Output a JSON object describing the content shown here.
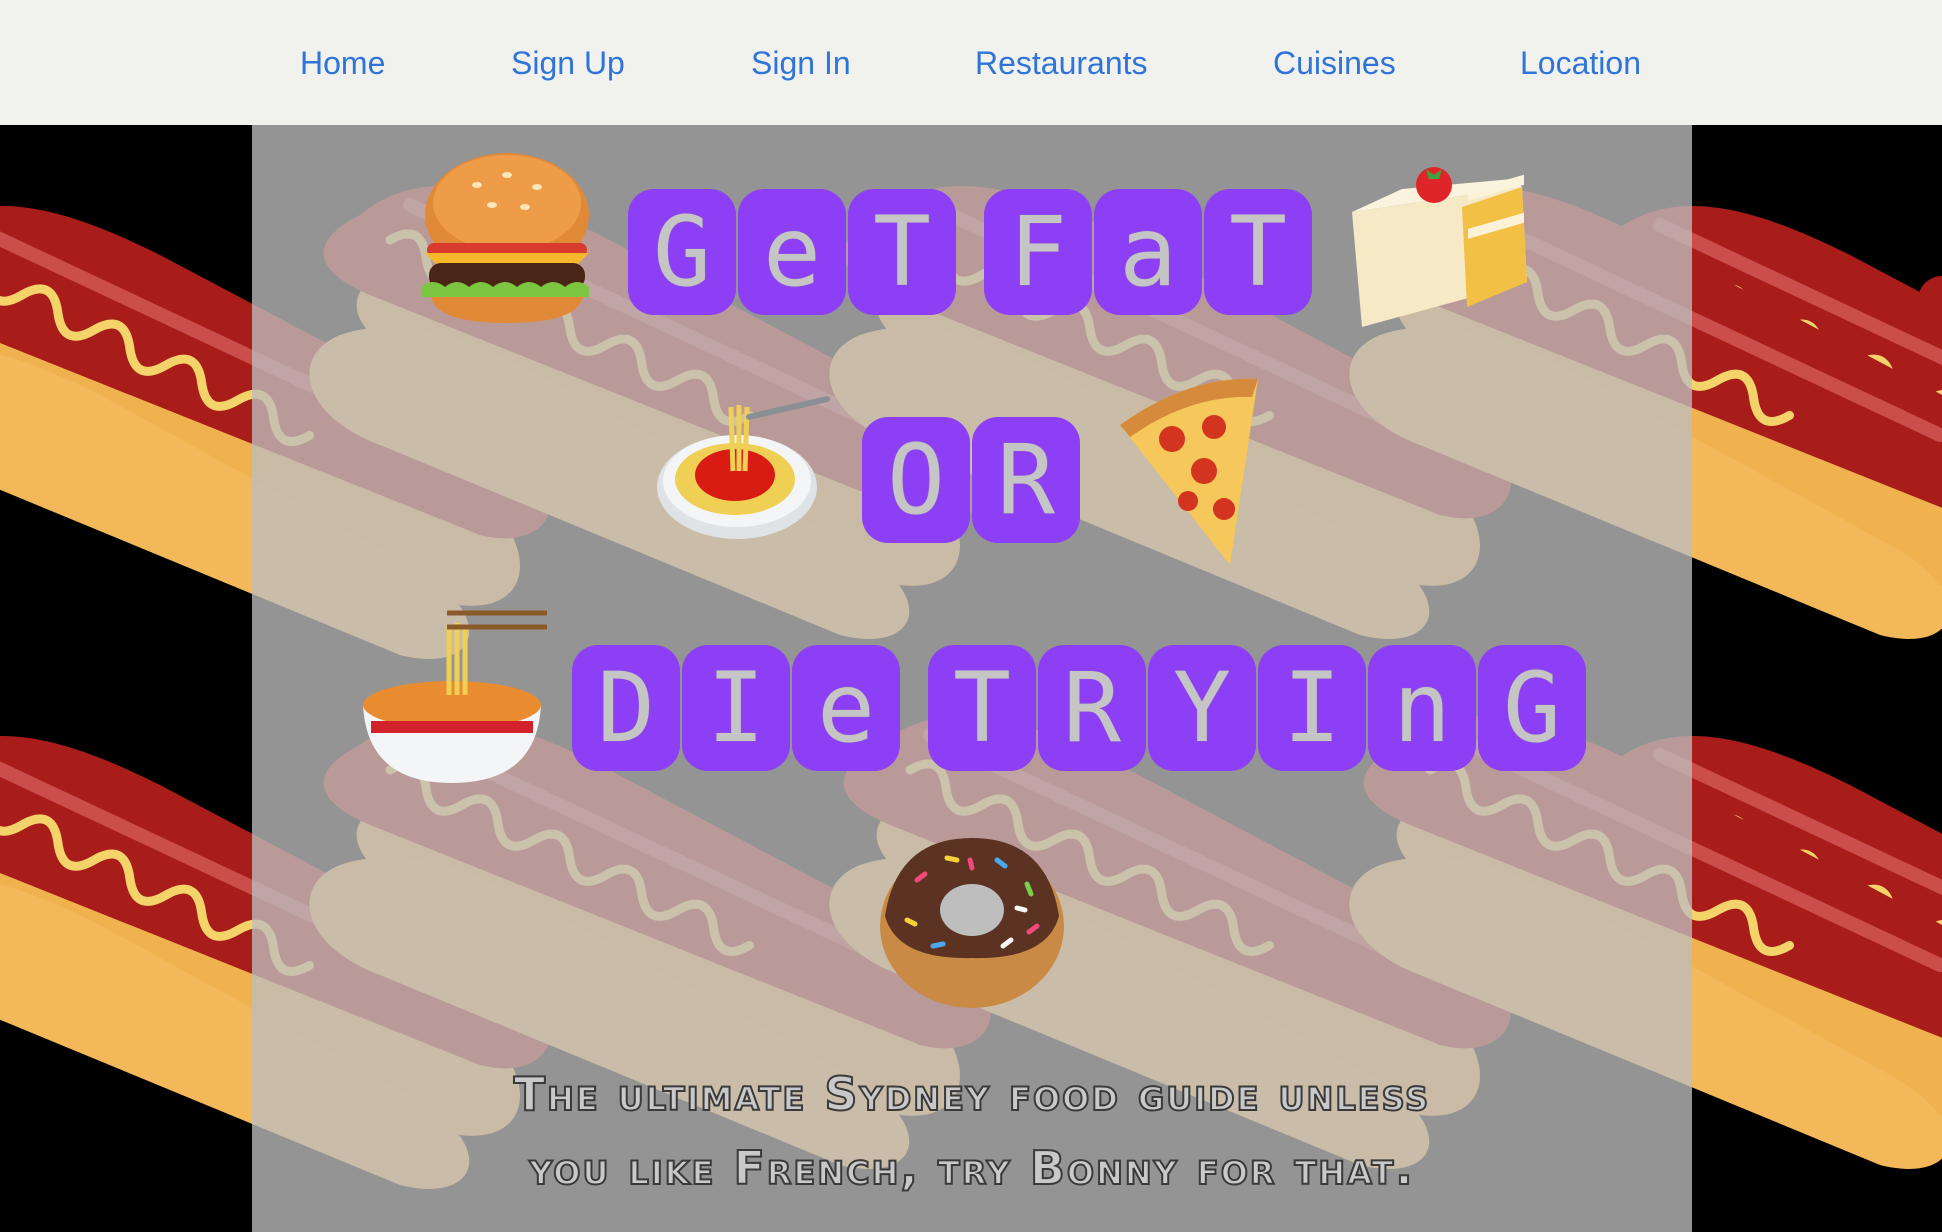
{
  "nav": {
    "items": [
      {
        "label": "Home"
      },
      {
        "label": "Sign Up"
      },
      {
        "label": "Sign In"
      },
      {
        "label": "Restaurants"
      },
      {
        "label": "Cuisines"
      },
      {
        "label": "Location"
      }
    ]
  },
  "hero": {
    "line1_word1": [
      "G",
      "e",
      "T"
    ],
    "line1_word2": [
      "F",
      "a",
      "T"
    ],
    "line2": [
      "O",
      "R"
    ],
    "line3_word1": [
      "D",
      "I",
      "e"
    ],
    "line3_word2": [
      "T",
      "R",
      "Y",
      "I",
      "n",
      "G"
    ],
    "tagline_line1": "The ultimate Sydney food guide unless",
    "tagline_line2": "you like French, try Bonny for that."
  },
  "emojis": {
    "burger": "🍔",
    "cake": "🍰",
    "spaghetti": "🍝",
    "pizza": "🍕",
    "ramen": "🍜",
    "donut": "🍩"
  },
  "colors": {
    "nav_bg": "#f1f2ee",
    "nav_link": "#2f74d8",
    "tile_purple": "#8c3ff5",
    "panel_gray": "#bebebe",
    "background": "#000000"
  }
}
